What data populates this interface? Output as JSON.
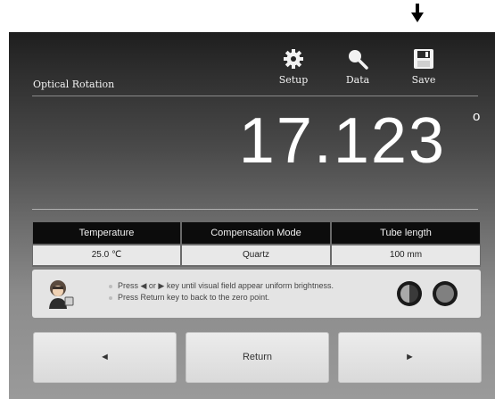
{
  "header": {
    "title": "Optical Rotation",
    "setup_label": "Setup",
    "data_label": "Data",
    "save_label": "Save"
  },
  "reading": {
    "value": "17.123",
    "unit_symbol": "o"
  },
  "params": {
    "columns": [
      {
        "header": "Temperature",
        "value": "25.0 ℃"
      },
      {
        "header": "Compensation Mode",
        "value": "Quartz"
      },
      {
        "header": "Tube length",
        "value": "100  mm"
      }
    ]
  },
  "instructions": {
    "line1": "Press ◀ or ▶ key until visual field appear uniform brightness.",
    "line2": "Press Return key to back to the zero point."
  },
  "buttons": {
    "left": "◄",
    "return_label": "Return",
    "right": "►"
  },
  "colors": {
    "header_bg": "#0c0c0c",
    "value_bg": "#e8e8e8",
    "button_bg": "#e4e4e4"
  }
}
